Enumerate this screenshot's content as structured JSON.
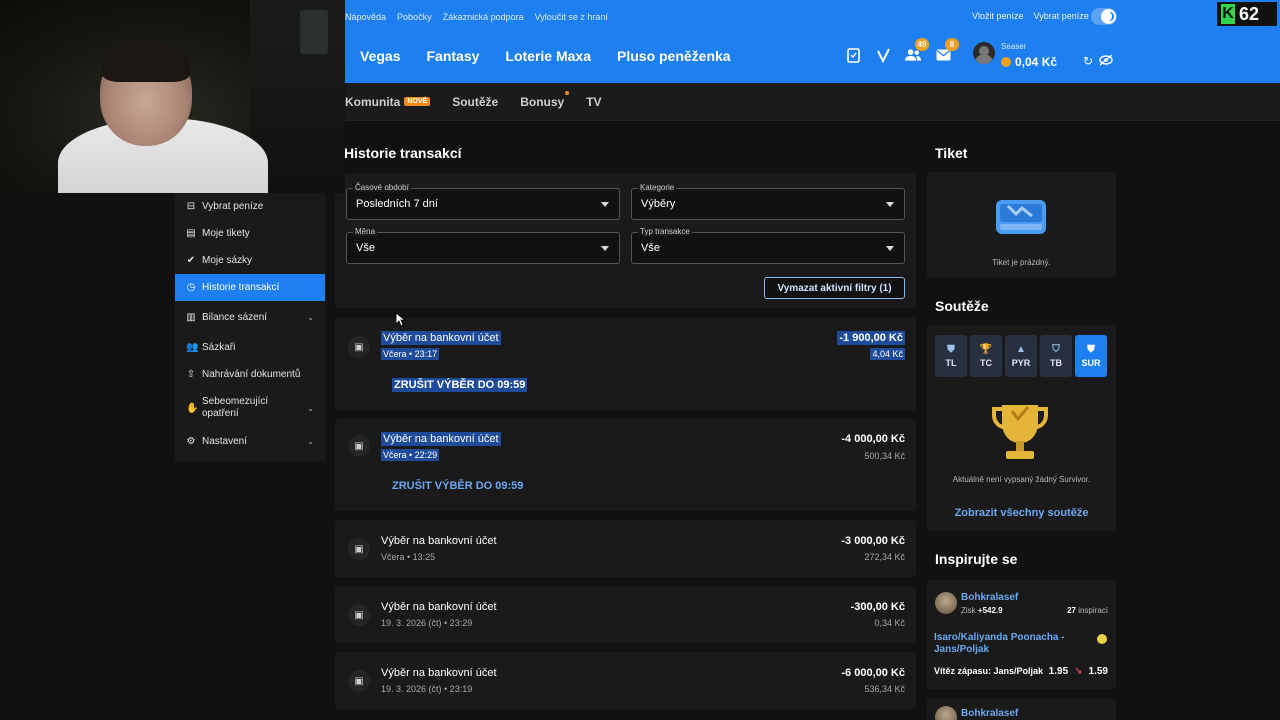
{
  "topbar": {
    "links": [
      "Nápověda",
      "Pobočky",
      "Zákaznická podpora",
      "Vyloučit se z hraní"
    ],
    "deposit": "Vložit peníze",
    "withdraw": "Vybrat peníze",
    "brand_color": "#1e7ff0"
  },
  "overlay": {
    "count": "62"
  },
  "mainnav": [
    "Vegas",
    "Fantasy",
    "Loterie Maxa",
    "Pluso peněženka"
  ],
  "nav_icons": [
    {
      "icon": "ticket-icon",
      "badge": ""
    },
    {
      "icon": "checkmark-icon",
      "badge": ""
    },
    {
      "icon": "users-icon",
      "badge": "49"
    },
    {
      "icon": "mail-icon",
      "badge": "8"
    }
  ],
  "user": {
    "name": "Seaser",
    "balance": "0,04 Kč"
  },
  "subnav": {
    "komunita": "Komunita",
    "nove": "NOVÉ",
    "souteze": "Soutěže",
    "bonusy": "Bonusy",
    "tv": "TV"
  },
  "sidebar": {
    "items": [
      {
        "label": "Vybrat peníze",
        "icon": "withdraw-icon"
      },
      {
        "label": "Moje tikety",
        "icon": "tickets-icon"
      },
      {
        "label": "Moje sázky",
        "icon": "bets-icon"
      },
      {
        "label": "Historie transakcí",
        "icon": "history-icon",
        "active": true
      },
      {
        "label": "Bilance sázení",
        "icon": "chart-icon"
      },
      {
        "label": "Sázkaři",
        "icon": "users-icon"
      },
      {
        "label": "Nahrávání dokumentů",
        "icon": "upload-icon"
      },
      {
        "label": "Sebeomezující opatření",
        "icon": "hand-icon"
      },
      {
        "label": "Nastavení",
        "icon": "gear-icon"
      }
    ]
  },
  "main": {
    "title": "Historie transakcí",
    "filters": {
      "period": {
        "label": "Časové období",
        "value": "Posledních 7 dní"
      },
      "category": {
        "label": "Kategorie",
        "value": "Výběry"
      },
      "currency": {
        "label": "Měna",
        "value": "Vše"
      },
      "type": {
        "label": "Typ transakce",
        "value": "Vše"
      }
    },
    "clear_filters": "Vymazat aktivní filtry (1)"
  },
  "transactions": [
    {
      "title": "Výběr na bankovní účet",
      "date": "Včera • 23:17",
      "amount": "-1 900,00 Kč",
      "sub": "4,04 Kč",
      "cancel": "ZRUŠIT VÝBĚR DO 09:59"
    },
    {
      "title": "Výběr na bankovní účet",
      "date": "Včera • 22:29",
      "amount": "-4 000,00 Kč",
      "sub": "500,34 Kč",
      "cancel": "ZRUŠIT VÝBĚR DO 09:59"
    },
    {
      "title": "Výběr na bankovní účet",
      "date": "Včera • 13:25",
      "amount": "-3 000,00 Kč",
      "sub": "272,34 Kč"
    },
    {
      "title": "Výběr na bankovní účet",
      "date": "19. 3. 2026 (čt) • 23:29",
      "amount": "-300,00 Kč",
      "sub": "0,34 Kč"
    },
    {
      "title": "Výběr na bankovní účet",
      "date": "19. 3. 2026 (čt) • 23:19",
      "amount": "-6 000,00 Kč",
      "sub": "536,34 Kč"
    }
  ],
  "ticket": {
    "title": "Tiket",
    "empty": "Tiket je prázdný."
  },
  "competitions": {
    "title": "Soutěže",
    "tabs": [
      "TL",
      "TC",
      "PYR",
      "TB",
      "SUR"
    ],
    "active_tab": "SUR",
    "empty": "Aktuálně není vypsaný žádný Survivor.",
    "link": "Zobrazit všechny soutěže"
  },
  "inspire": {
    "title": "Inspirujte se",
    "card": {
      "name": "Bohkralasef",
      "profit_label": "Zisk",
      "profit": "+542.9",
      "count": "27",
      "count_label": "inspirací",
      "match": "Isaro/Kaliyanda Poonacha - Jans/Poljak",
      "bet": "Vítěz zápasu: Jans/Poljak",
      "odds_old": "1.95",
      "odds_new": "1.59"
    },
    "next_name": "Bohkralasef"
  }
}
